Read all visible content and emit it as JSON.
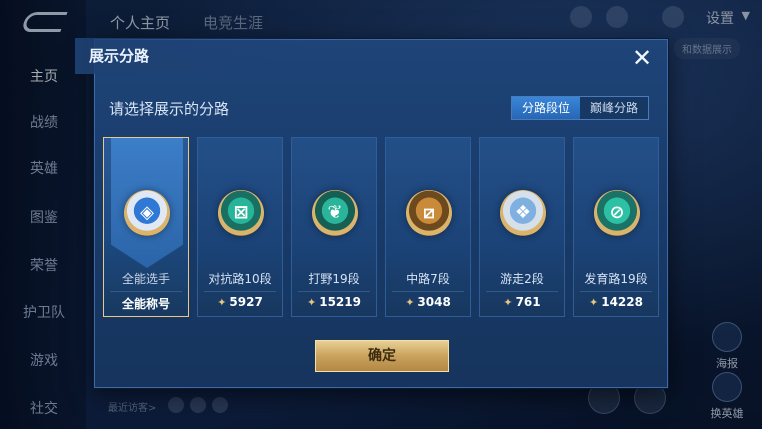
{
  "background": {
    "top_tabs": [
      "个人主页",
      "电竞生涯"
    ],
    "settings_label": "设置",
    "top_pill": "和数据展示",
    "nav": [
      "主页",
      "战绩",
      "英雄",
      "图鉴",
      "荣誉",
      "护卫队",
      "游戏",
      "社交"
    ],
    "recent_label": "最近访客>",
    "right_buttons": [
      "海报",
      "换英雄"
    ]
  },
  "dialog": {
    "title": "展示分路",
    "close_label": "✕",
    "prompt": "请选择展示的分路",
    "segments": [
      {
        "label": "分路段位",
        "active": true
      },
      {
        "label": "巅峰分路",
        "active": false
      }
    ],
    "cards": [
      {
        "name": "全能选手",
        "subtitle": "全能称号",
        "selected": true,
        "icon": "all-round-icon",
        "glyph": "◈",
        "c1": "#2f78d6",
        "c2": "#e0e8f5"
      },
      {
        "name": "对抗路10段",
        "score": "5927",
        "selected": false,
        "icon": "clash-lane-icon",
        "glyph": "⊠",
        "c1": "#27b59a",
        "c2": "#1a6f63"
      },
      {
        "name": "打野19段",
        "score": "15219",
        "selected": false,
        "icon": "jungle-icon",
        "glyph": "❦",
        "c1": "#2ab59b",
        "c2": "#155f55"
      },
      {
        "name": "中路7段",
        "score": "3048",
        "selected": false,
        "icon": "mid-lane-icon",
        "glyph": "⧄",
        "c1": "#c98a3a",
        "c2": "#6d4a1e"
      },
      {
        "name": "游走2段",
        "score": "761",
        "selected": false,
        "icon": "roam-icon",
        "glyph": "❖",
        "c1": "#7fb0e0",
        "c2": "#d6e0ea"
      },
      {
        "name": "发育路19段",
        "score": "14228",
        "selected": false,
        "icon": "farm-lane-icon",
        "glyph": "⊘",
        "c1": "#2cc0a4",
        "c2": "#1b7266"
      }
    ],
    "points_icon": "✦",
    "confirm_label": "确定"
  }
}
